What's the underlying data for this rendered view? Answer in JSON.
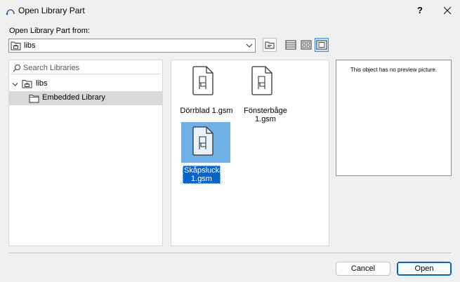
{
  "window": {
    "title": "Open Library Part",
    "help_label": "?"
  },
  "source": {
    "label": "Open Library Part from:",
    "selected": "libs"
  },
  "search": {
    "placeholder": "Search Libraries"
  },
  "tree": {
    "root_label": "libs",
    "child_label": "Embedded Library"
  },
  "files": [
    {
      "name": "Dörrblad 1.gsm"
    },
    {
      "name": "Fönsterbåge 1.gsm"
    },
    {
      "name": "Skåpslucka 1.gsm"
    }
  ],
  "preview": {
    "message": "This object has no preview picture."
  },
  "buttons": {
    "cancel": "Cancel",
    "open": "Open"
  },
  "colors": {
    "selection_light": "#6fb0e6",
    "selection_dark": "#0a64c8",
    "accent": "#0067c0"
  }
}
